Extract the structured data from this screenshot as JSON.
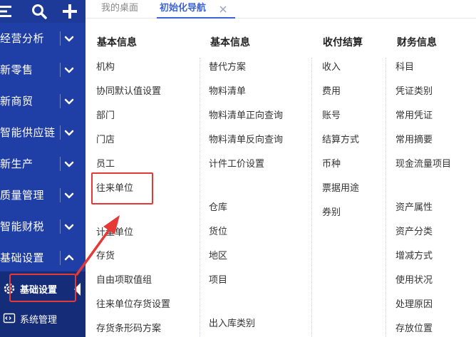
{
  "sidebar": {
    "top_icons": [
      "collapse-menu-icon",
      "search-icon",
      "plus-icon"
    ],
    "items": [
      {
        "label": "经营分析"
      },
      {
        "label": "新零售"
      },
      {
        "label": "新商贸"
      },
      {
        "label": "智能供应链"
      },
      {
        "label": "新生产"
      },
      {
        "label": "质量管理"
      },
      {
        "label": "智能财税"
      },
      {
        "label": "基础设置",
        "expanded": true
      }
    ],
    "submenu": [
      {
        "label": "基础设置",
        "icon": "gear-icon",
        "active": true
      },
      {
        "label": "系统管理",
        "icon": "code-window-icon"
      }
    ]
  },
  "tabs": [
    {
      "label": "我的桌面"
    },
    {
      "label": "初始化导航",
      "active": true
    }
  ],
  "columns": [
    {
      "header": "基本信息",
      "items": [
        "机构",
        "协同默认值设置",
        "部门",
        "门店",
        "员工",
        "往来单位",
        "计量单位",
        "存货",
        "自由项取值组",
        "往来单位存货设置",
        "存货条形码方案"
      ]
    },
    {
      "header": "基本信息",
      "items": [
        "替代方案",
        "物料清单",
        "物料清单正向查询",
        "物料清单反向查询",
        "计件工价设置",
        "仓库",
        "货位",
        "地区",
        "项目",
        "出入库类别"
      ]
    },
    {
      "header": "收付结算",
      "items": [
        "收入",
        "费用",
        "账号",
        "结算方式",
        "币种",
        "票据用途",
        "券别"
      ]
    },
    {
      "header": "财务信息",
      "items": [
        "科目",
        "凭证类别",
        "常用凭证",
        "常用摘要",
        "现金流量项目",
        "资产属性",
        "资产分类",
        "增减方式",
        "使用状况",
        "处理原因",
        "存放位置"
      ]
    }
  ],
  "colors": {
    "sidebar": "#1f3fa6",
    "sidebar_top": "#1d3a99",
    "submenu": "#152c78",
    "accent": "#3b63d8",
    "annotation": "#e53935"
  }
}
